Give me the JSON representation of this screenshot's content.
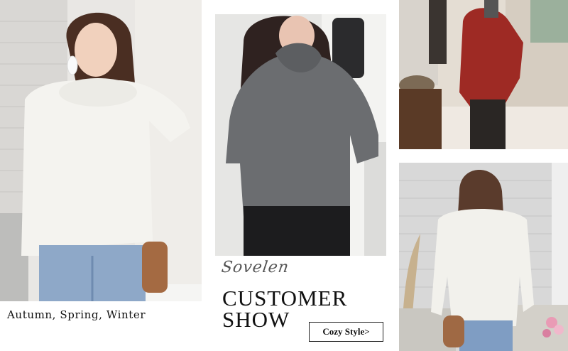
{
  "caption": {
    "seasons": "Autumn, Spring, Winter"
  },
  "customer_show": {
    "brand": "Sovelen",
    "title_line1": "CUSTOMER",
    "title_line2": "SHOW",
    "button_label": "Cozy Style>"
  },
  "photos": [
    {
      "name": "model-white-sweater-photo",
      "sweater_color": "#f4f3ef"
    },
    {
      "name": "customer-gray-sweater-photo",
      "sweater_color": "#6b6d70"
    },
    {
      "name": "customer-red-sweater-photo",
      "sweater_color": "#9e2a24"
    },
    {
      "name": "model-white-sweater-back-photo",
      "sweater_color": "#f2f1ec"
    }
  ]
}
